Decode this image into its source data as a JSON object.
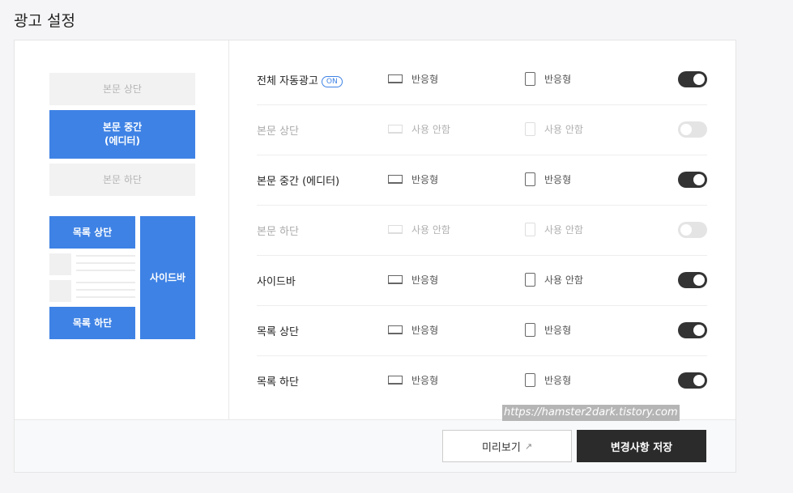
{
  "page_title": "광고 설정",
  "preview": {
    "top": "본문 상단",
    "middle_line1": "본문 중간",
    "middle_line2": "(에디터)",
    "bottom": "본문 하단",
    "list_top": "목록 상단",
    "list_bottom": "목록 하단",
    "sidebar": "사이드바"
  },
  "rows": [
    {
      "label": "전체 자동광고",
      "badge": "ON",
      "pc": "반응형",
      "mobile": "반응형",
      "enabled": true
    },
    {
      "label": "본문 상단",
      "pc": "사용 안함",
      "mobile": "사용 안함",
      "enabled": false
    },
    {
      "label": "본문 중간 (에디터)",
      "pc": "반응형",
      "mobile": "반응형",
      "enabled": true
    },
    {
      "label": "본문 하단",
      "pc": "사용 안함",
      "mobile": "사용 안함",
      "enabled": false
    },
    {
      "label": "사이드바",
      "pc": "반응형",
      "mobile": "사용 안함",
      "enabled": true
    },
    {
      "label": "목록 상단",
      "pc": "반응형",
      "mobile": "반응형",
      "enabled": true
    },
    {
      "label": "목록 하단",
      "pc": "반응형",
      "mobile": "반응형",
      "enabled": true
    }
  ],
  "footer": {
    "preview_label": "미리보기",
    "save_label": "변경사항 저장"
  },
  "watermark": "https://hamster2dark.tistory.com",
  "colors": {
    "accent": "#3e82e5",
    "dark": "#2b2b2b"
  },
  "icons": [
    "pc-icon",
    "mobile-icon",
    "external-link-icon"
  ]
}
